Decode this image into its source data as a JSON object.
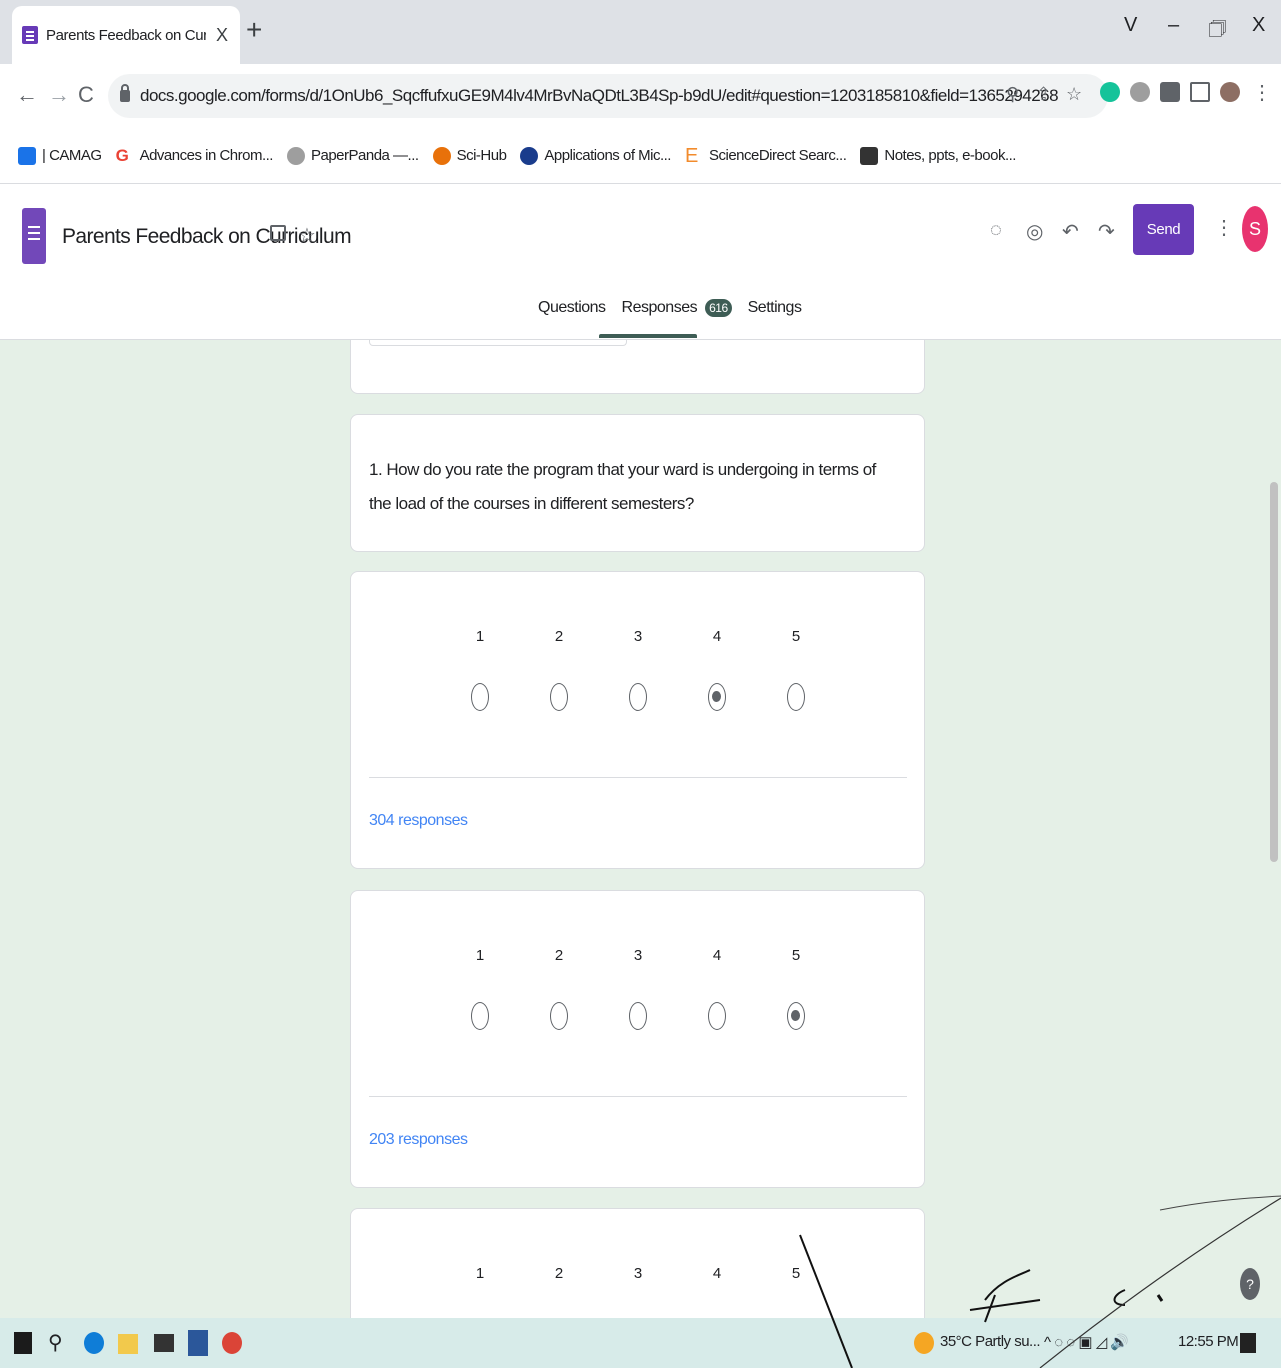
{
  "browser": {
    "tab_title": "Parents Feedback on Curriculum",
    "tab_close": "X",
    "new_tab": "+",
    "window_controls": [
      "V",
      "–",
      "🗇",
      "X"
    ],
    "url": "docs.google.com/forms/d/1OnUb6_SqcffufxuGE9M4lv4MrBvNaQDtL3B4Sp-b9dU/edit#question=1203185810&field=1365294268"
  },
  "bookmarks": [
    {
      "label": "| CAMAG",
      "icon": "camag-icon",
      "color": "#1a73e8"
    },
    {
      "label": "Advances in Chrom...",
      "icon": "google-icon",
      "color": "#ea4335"
    },
    {
      "label": "PaperPanda —...",
      "icon": "panda-icon",
      "color": "#555555"
    },
    {
      "label": "Sci-Hub",
      "icon": "scihub-icon",
      "color": "#e8710a"
    },
    {
      "label": "Applications of Mic...",
      "icon": "applications-icon",
      "color": "#1a3c8c"
    },
    {
      "label": "ScienceDirect Searc...",
      "icon": "elsevier-icon",
      "color": "#f28b2c"
    },
    {
      "label": "Notes, ppts, e-book...",
      "icon": "notes-icon",
      "color": "#333333"
    }
  ],
  "form": {
    "title": "Parents Feedback on Curriculum",
    "send_label": "Send",
    "avatar_letter": "S",
    "tabs": {
      "questions": "Questions",
      "responses": "Responses",
      "responses_count": "616",
      "settings": "Settings"
    }
  },
  "question": {
    "text": "1. How do you rate the program that your ward is undergoing in terms of the load of the courses in different semesters?"
  },
  "scale_options": [
    "1",
    "2",
    "3",
    "4",
    "5"
  ],
  "response_cards": [
    {
      "selected": "4",
      "responses_label": "304 responses"
    },
    {
      "selected": "5",
      "responses_label": "203 responses"
    },
    {
      "selected": "",
      "responses_label": ""
    }
  ],
  "help_label": "?",
  "taskbar": {
    "weather": "35°C  Partly su...",
    "time": "12:55 PM"
  },
  "colors": {
    "accent": "#673ab7",
    "tab_accent": "#3e5d55",
    "background": "#e5f0e7",
    "link": "#4285f4"
  }
}
